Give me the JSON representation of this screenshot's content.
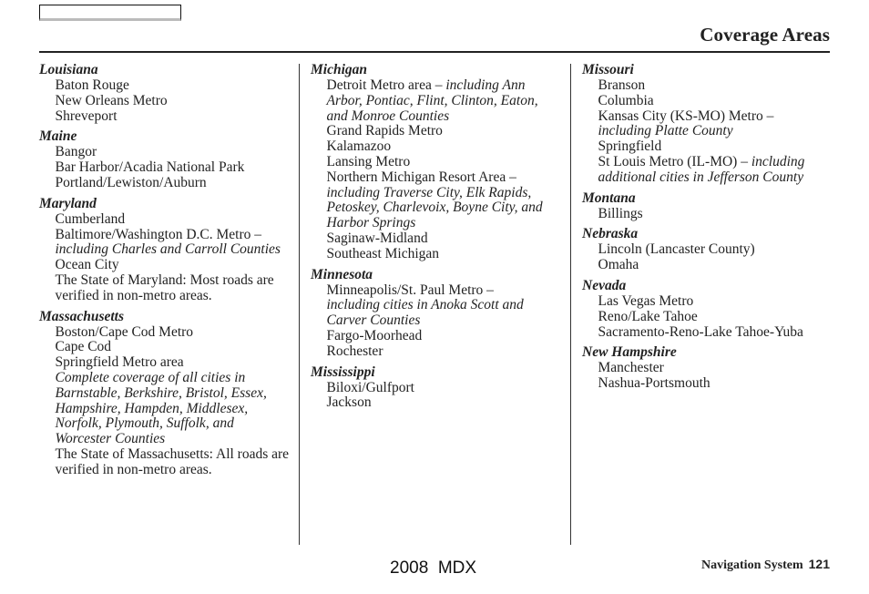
{
  "header": {
    "title": "Coverage Areas"
  },
  "columns": [
    [
      {
        "state": "Louisiana",
        "entries": [
          {
            "text": "Baton Rouge"
          },
          {
            "text": "New Orleans Metro"
          },
          {
            "text": "Shreveport"
          }
        ]
      },
      {
        "state": "Maine",
        "entries": [
          {
            "text": "Bangor"
          },
          {
            "text": "Bar Harbor/Acadia National Park"
          },
          {
            "text": "Portland/Lewiston/Auburn"
          }
        ]
      },
      {
        "state": "Maryland",
        "entries": [
          {
            "text": "Cumberland"
          },
          {
            "text": "Baltimore/Washington D.C. Metro –",
            "italic": "including Charles and Carroll Counties",
            "break": true
          },
          {
            "text": "Ocean City"
          },
          {
            "text": "The State of Maryland: Most roads are verified in non-metro areas."
          }
        ]
      },
      {
        "state": "Massachusetts",
        "entries": [
          {
            "text": "Boston/Cape Cod Metro"
          },
          {
            "text": "Cape Cod"
          },
          {
            "text": "Springfield Metro area"
          },
          {
            "text": "",
            "italic": "Complete coverage of all cities in Barnstable, Berkshire, Bristol, Essex, Hampshire, Hampden, Middlesex, Norfolk, Plymouth, Suffolk, and Worcester Counties"
          },
          {
            "text": "The State of Massachusetts: All roads are verified in non-metro areas."
          }
        ]
      }
    ],
    [
      {
        "state": "Michigan",
        "entries": [
          {
            "text": "Detroit Metro area –",
            "italic": "including Ann Arbor, Pontiac, Flint, Clinton, Eaton, and Monroe Counties"
          },
          {
            "text": "Grand Rapids Metro"
          },
          {
            "text": "Kalamazoo"
          },
          {
            "text": "Lansing Metro"
          },
          {
            "text": "Northern Michigan Resort Area –",
            "italic": "including Traverse City, Elk Rapids, Petoskey, Charlevoix, Boyne City, and Harbor Springs",
            "break": true
          },
          {
            "text": "Saginaw-Midland"
          },
          {
            "text": "Southeast Michigan"
          }
        ]
      },
      {
        "state": "Minnesota",
        "entries": [
          {
            "text": "Minneapolis/St. Paul Metro –",
            "italic": "including cities in Anoka Scott and Carver Counties",
            "break": true
          },
          {
            "text": "Fargo-Moorhead"
          },
          {
            "text": "Rochester"
          }
        ]
      },
      {
        "state": "Mississippi",
        "entries": [
          {
            "text": "Biloxi/Gulfport"
          },
          {
            "text": "Jackson"
          }
        ]
      }
    ],
    [
      {
        "state": "Missouri",
        "entries": [
          {
            "text": "Branson"
          },
          {
            "text": "Columbia"
          },
          {
            "text": "Kansas City (KS-MO) Metro –",
            "italic": "including Platte County",
            "break": true
          },
          {
            "text": "Springfield"
          },
          {
            "text": "St Louis Metro (IL-MO) –",
            "italic": "including additional cities in Jefferson County"
          }
        ]
      },
      {
        "state": "Montana",
        "entries": [
          {
            "text": "Billings"
          }
        ]
      },
      {
        "state": "Nebraska",
        "entries": [
          {
            "text": "Lincoln (Lancaster County)"
          },
          {
            "text": "Omaha"
          }
        ]
      },
      {
        "state": "Nevada",
        "entries": [
          {
            "text": "Las Vegas Metro"
          },
          {
            "text": "Reno/Lake Tahoe"
          },
          {
            "text": "Sacramento-Reno-Lake Tahoe-Yuba"
          }
        ]
      },
      {
        "state": "New Hampshire",
        "entries": [
          {
            "text": "Manchester"
          },
          {
            "text": "Nashua-Portsmouth"
          }
        ]
      }
    ]
  ],
  "footer": {
    "model": "2008  MDX",
    "section": "Navigation System",
    "page_number": "121"
  }
}
